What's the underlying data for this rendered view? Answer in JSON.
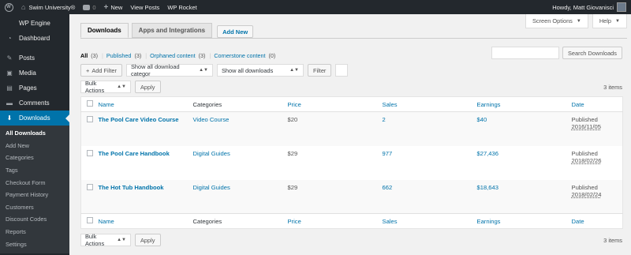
{
  "admin_bar": {
    "site_name": "Swim University®",
    "comments_count": "0",
    "new_label": "New",
    "view_posts_label": "View Posts",
    "wp_rocket_label": "WP Rocket",
    "howdy": "Howdy, Matt Giovanisci"
  },
  "sidebar": {
    "top_item": "WP Engine",
    "items": [
      {
        "label": "Dashboard",
        "icon": "dashboard-icon",
        "glyph": "◔"
      },
      {
        "label": "Posts",
        "icon": "pushpin-icon",
        "glyph": "✎"
      },
      {
        "label": "Media",
        "icon": "media-icon",
        "glyph": "▣"
      },
      {
        "label": "Pages",
        "icon": "pages-icon",
        "glyph": "▤"
      },
      {
        "label": "Comments",
        "icon": "comments-icon",
        "glyph": "▬"
      },
      {
        "label": "Downloads",
        "icon": "download-icon",
        "glyph": "⬇"
      }
    ],
    "submenu": [
      "All Downloads",
      "Add New",
      "Categories",
      "Tags",
      "Checkout Form",
      "Payment History",
      "Customers",
      "Discount Codes",
      "Reports",
      "Settings"
    ]
  },
  "screen_meta": {
    "screen_options": "Screen Options",
    "help": "Help"
  },
  "tabs": {
    "downloads": "Downloads",
    "apps": "Apps and Integrations",
    "add_new": "Add New"
  },
  "views": {
    "all": "All",
    "all_count": "(3)",
    "published": "Published",
    "published_count": "(3)",
    "orphaned": "Orphaned content",
    "orphaned_count": "(3)",
    "cornerstone": "Cornerstone content",
    "cornerstone_count": "(0)"
  },
  "search": {
    "button": "Search Downloads",
    "value": ""
  },
  "filters": {
    "add_filter": "Add Filter",
    "category_select": "Show all download categor",
    "downloads_select": "Show all downloads",
    "filter_button": "Filter"
  },
  "bulk": {
    "select": "Bulk Actions",
    "apply": "Apply",
    "items_count": "3 items"
  },
  "table": {
    "columns": {
      "name": "Name",
      "categories": "Categories",
      "price": "Price",
      "sales": "Sales",
      "earnings": "Earnings",
      "date": "Date"
    },
    "rows": [
      {
        "name": "The Pool Care Video Course",
        "category": "Video Course",
        "price": "$20",
        "sales": "2",
        "earnings": "$40",
        "status": "Published",
        "date": "2016/11/05"
      },
      {
        "name": "The Pool Care Handbook",
        "category": "Digital Guides",
        "price": "$29",
        "sales": "977",
        "earnings": "$27,436",
        "status": "Published",
        "date": "2018/02/26"
      },
      {
        "name": "The Hot Tub Handbook",
        "category": "Digital Guides",
        "price": "$29",
        "sales": "662",
        "earnings": "$18,643",
        "status": "Published",
        "date": "2018/02/24"
      }
    ]
  },
  "colors": {
    "admin_dark": "#23282d",
    "accent": "#0073aa",
    "link": "#0073aa"
  }
}
